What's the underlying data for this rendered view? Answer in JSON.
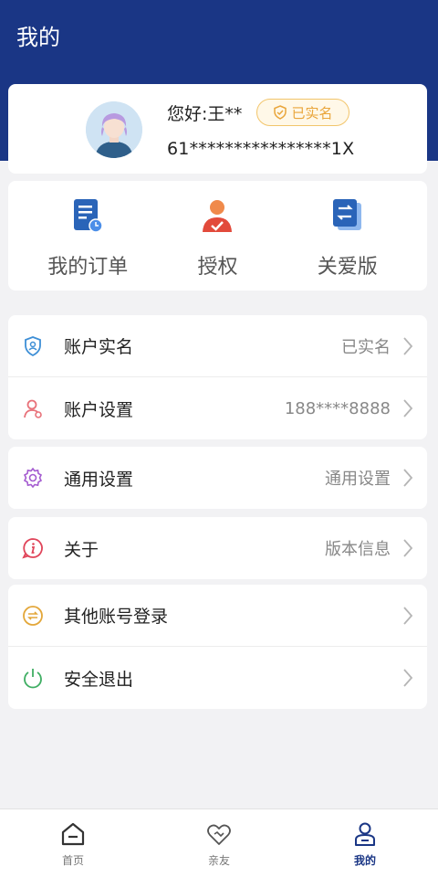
{
  "header": {
    "title": "我的"
  },
  "profile": {
    "greeting": "您好:王**",
    "badge": "已实名",
    "id_number": "61****************1X"
  },
  "quick_actions": [
    {
      "label": "我的订单",
      "icon": "order-icon"
    },
    {
      "label": "授权",
      "icon": "user-authorize-icon"
    },
    {
      "label": "关爱版",
      "icon": "care-mode-icon"
    }
  ],
  "menu": {
    "realname": {
      "label": "账户实名",
      "value": "已实名",
      "icon": "shield-user-icon"
    },
    "account_settings": {
      "label": "账户设置",
      "value": "188****8888",
      "icon": "user-settings-icon"
    },
    "general_settings": {
      "label": "通用设置",
      "value": "通用设置",
      "icon": "gear-icon"
    },
    "about": {
      "label": "关于",
      "value": "版本信息",
      "icon": "info-icon"
    },
    "other_login": {
      "label": "其他账号登录",
      "value": "",
      "icon": "switch-account-icon"
    },
    "logout": {
      "label": "安全退出",
      "value": "",
      "icon": "power-icon"
    }
  },
  "tabbar": [
    {
      "label": "首页",
      "icon": "home-icon",
      "active": false
    },
    {
      "label": "亲友",
      "icon": "heart-icon",
      "active": false
    },
    {
      "label": "我的",
      "icon": "user-icon",
      "active": true
    }
  ],
  "colors": {
    "header_bg": "#1a3685",
    "accent_orange": "#e8663a",
    "badge_gold": "#e9a53a",
    "active_tab": "#1a3685"
  }
}
